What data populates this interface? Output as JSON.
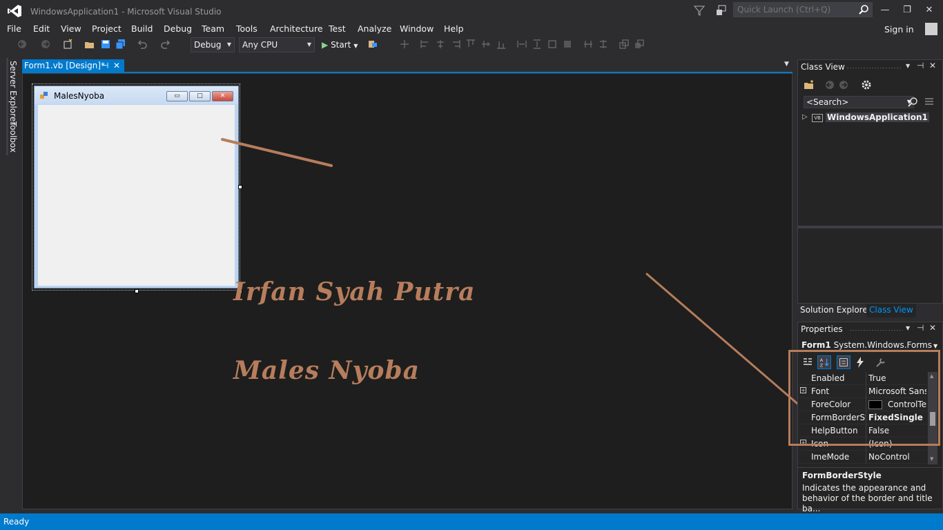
{
  "window": {
    "title": "WindowsApplication1 - Microsoft Visual Studio",
    "quick_launch_placeholder": "Quick Launch (Ctrl+Q)",
    "sign_in": "Sign in",
    "min_glyph": "—",
    "max_glyph": "❐",
    "close_glyph": "✕"
  },
  "menu": [
    "File",
    "Edit",
    "View",
    "Project",
    "Build",
    "Debug",
    "Team",
    "Tools",
    "Architecture",
    "Test",
    "Analyze",
    "Window",
    "Help"
  ],
  "toolbar": {
    "config": "Debug",
    "platform": "Any CPU",
    "start": "Start",
    "start_glyph": "▶",
    "dropdown_glyph": "▼"
  },
  "side_tabs": [
    "Server Explorer",
    "Toolbox"
  ],
  "doc_tab": {
    "label": "Form1.vb [Design]*",
    "pin": "⊣",
    "close": "✕"
  },
  "form": {
    "title": "MalesNyoba",
    "min": "▭",
    "max": "□",
    "close": "✕"
  },
  "annotations": {
    "author": "Irfan Syah Putra",
    "project": "Males Nyoba"
  },
  "class_view": {
    "title": "Class View",
    "search_placeholder": "<Search>",
    "tree_root": "WindowsApplication1",
    "badge": "VB",
    "expander": "▷"
  },
  "panel_tabs": [
    "Solution Explorer",
    "Class View"
  ],
  "properties": {
    "title": "Properties",
    "object_name": "Form1",
    "object_type": "System.Windows.Forms.Fc",
    "rows": [
      {
        "name": "Enabled",
        "value": "True",
        "expand": false
      },
      {
        "name": "Font",
        "value": "Microsoft Sans S",
        "expand": true
      },
      {
        "name": "ForeColor",
        "value": "ControlTex",
        "expand": false,
        "swatch": "#000000"
      },
      {
        "name": "FormBorderSty",
        "value": "FixedSingle",
        "expand": false,
        "bold": true
      },
      {
        "name": "HelpButton",
        "value": "False",
        "expand": false
      },
      {
        "name": "Icon",
        "value": "(Icon)",
        "expand": true
      },
      {
        "name": "ImeMode",
        "value": "NoControl",
        "expand": false
      }
    ],
    "desc_title": "FormBorderStyle",
    "desc_text": "Indicates the appearance and behavior of the border and title ba..."
  },
  "status": "Ready",
  "colors": {
    "accent": "#007acc",
    "annotation": "#b77d5c"
  }
}
